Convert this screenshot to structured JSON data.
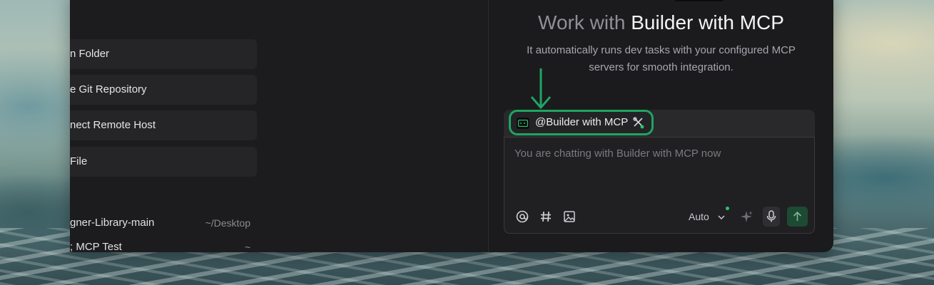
{
  "left_pane": {
    "actions": [
      {
        "label": "n Folder"
      },
      {
        "label": "e Git Repository"
      },
      {
        "label": "nect Remote Host"
      },
      {
        "label": " File"
      }
    ],
    "recent": [
      {
        "name": "gner-Library-main",
        "path": "~/Desktop"
      },
      {
        "name": "; MCP Test",
        "path": "~"
      }
    ]
  },
  "right_pane": {
    "headline_prefix": "Work with",
    "headline_agent": "Builder with MCP",
    "description": "It automatically runs dev tasks with your configured MCP servers for smooth integration.",
    "agent_chip": {
      "label": "@Builder with MCP"
    },
    "input": {
      "placeholder": "You are chatting with Builder with MCP now"
    },
    "mode": {
      "label": "Auto"
    }
  },
  "colors": {
    "accent_green": "#1fa463",
    "window_bg": "#1b1b1d"
  },
  "icons": [
    "at-icon",
    "hash-icon",
    "image-icon",
    "chevron-down-icon",
    "sparkle-icon",
    "microphone-icon",
    "arrow-up-icon",
    "tools-icon",
    "terminal-icon",
    "arrow-down-icon"
  ]
}
